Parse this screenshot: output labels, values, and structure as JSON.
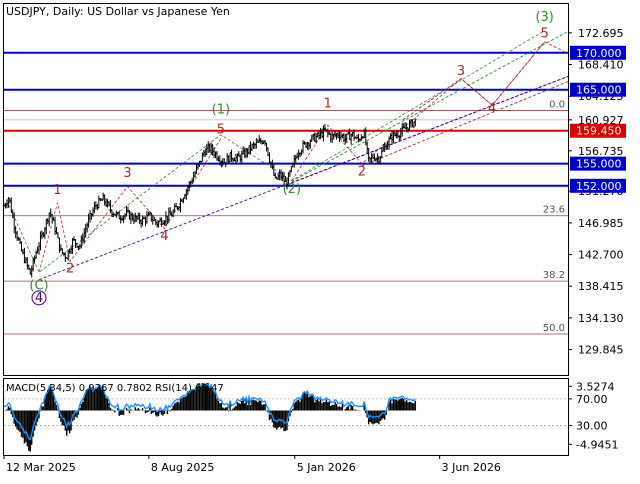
{
  "chart_data": {
    "type": "candlestick",
    "title": "USDJPY, Daily:  US Dollar vs Japanese Yen",
    "indicator_title": "MACD(5,34,5) 0.9267 0.7802 RSI(14) 65.47",
    "x_axis": {
      "tick_labels": [
        "12 Mar 2025",
        "8 Aug 2025",
        "5 Jan 2026",
        "3 Jun 2026"
      ],
      "tick_days": [
        0,
        149,
        299,
        448
      ]
    },
    "y_axis": {
      "ylim": [
        126.4,
        176.6
      ],
      "tick_labels": [
        "172.695",
        "168.410",
        "164.125",
        "160.927",
        "156.735",
        "151.270",
        "146.985",
        "142.700",
        "138.415",
        "134.130",
        "129.845"
      ],
      "tick_values": [
        172.695,
        168.41,
        164.125,
        160.927,
        156.735,
        151.27,
        146.985,
        142.7,
        138.415,
        134.13,
        129.845
      ]
    },
    "indicator_axis": {
      "ylim": [
        -6.5,
        4.6
      ],
      "tick_labels": [
        "3.5274",
        "70.00",
        "30.00",
        "-4.9451"
      ],
      "tick_values": [
        3.5274,
        1.7,
        -2.2,
        -4.9451
      ]
    },
    "levels": [
      {
        "label": "170.000",
        "value": 170.0,
        "color": "#0000cc"
      },
      {
        "label": "165.000",
        "value": 165.0,
        "color": "#0000cc"
      },
      {
        "label": "159.450",
        "value": 159.45,
        "color": "#dd0000"
      },
      {
        "label": "155.000",
        "value": 155.0,
        "color": "#0000cc"
      },
      {
        "label": "152.000",
        "value": 152.0,
        "color": "#0000cc"
      }
    ],
    "fibonacci": [
      {
        "label": "0.0",
        "value": 162.2
      },
      {
        "label": "23.6",
        "value": 147.95
      },
      {
        "label": "38.2",
        "value": 139.1
      },
      {
        "label": "50.0",
        "value": 131.95
      }
    ],
    "current_price": 160.927,
    "price_path": [
      {
        "d": 0,
        "p": 149.3
      },
      {
        "d": 5,
        "p": 150.5
      },
      {
        "d": 10,
        "p": 147.0
      },
      {
        "d": 17,
        "p": 143.5
      },
      {
        "d": 22,
        "p": 141.8
      },
      {
        "d": 27,
        "p": 140.1
      },
      {
        "d": 33,
        "p": 143.0
      },
      {
        "d": 40,
        "p": 145.6
      },
      {
        "d": 47,
        "p": 148.6
      },
      {
        "d": 53,
        "p": 146.0
      },
      {
        "d": 58,
        "p": 143.2
      },
      {
        "d": 64,
        "p": 142.4
      },
      {
        "d": 71,
        "p": 144.6
      },
      {
        "d": 78,
        "p": 143.9
      },
      {
        "d": 86,
        "p": 147.0
      },
      {
        "d": 94,
        "p": 149.3
      },
      {
        "d": 102,
        "p": 150.2
      },
      {
        "d": 110,
        "p": 148.7
      },
      {
        "d": 118,
        "p": 147.8
      },
      {
        "d": 126,
        "p": 148.2
      },
      {
        "d": 134,
        "p": 147.6
      },
      {
        "d": 142,
        "p": 147.3
      },
      {
        "d": 150,
        "p": 147.9
      },
      {
        "d": 157,
        "p": 146.9
      },
      {
        "d": 165,
        "p": 147.6
      },
      {
        "d": 172,
        "p": 148.1
      },
      {
        "d": 179,
        "p": 149.3
      },
      {
        "d": 186,
        "p": 151.1
      },
      {
        "d": 193,
        "p": 152.8
      },
      {
        "d": 200,
        "p": 154.7
      },
      {
        "d": 206,
        "p": 156.7
      },
      {
        "d": 212,
        "p": 157.1
      },
      {
        "d": 219,
        "p": 156.1
      },
      {
        "d": 226,
        "p": 155.2
      },
      {
        "d": 233,
        "p": 156.0
      },
      {
        "d": 240,
        "p": 155.7
      },
      {
        "d": 247,
        "p": 156.3
      },
      {
        "d": 254,
        "p": 157.2
      },
      {
        "d": 261,
        "p": 157.7
      },
      {
        "d": 268,
        "p": 158.4
      },
      {
        "d": 274,
        "p": 155.1
      },
      {
        "d": 279,
        "p": 152.7
      },
      {
        "d": 284,
        "p": 153.5
      },
      {
        "d": 290,
        "p": 152.3
      },
      {
        "d": 296,
        "p": 154.3
      },
      {
        "d": 302,
        "p": 156.6
      },
      {
        "d": 308,
        "p": 157.4
      },
      {
        "d": 316,
        "p": 158.3
      },
      {
        "d": 323,
        "p": 158.7
      },
      {
        "d": 330,
        "p": 159.4
      },
      {
        "d": 337,
        "p": 158.6
      },
      {
        "d": 344,
        "p": 159.1
      },
      {
        "d": 351,
        "p": 158.4
      },
      {
        "d": 358,
        "p": 159.0
      },
      {
        "d": 364,
        "p": 158.1
      },
      {
        "d": 370,
        "p": 159.3
      },
      {
        "d": 375,
        "p": 155.3
      },
      {
        "d": 380,
        "p": 156.0
      },
      {
        "d": 385,
        "p": 155.7
      },
      {
        "d": 392,
        "p": 157.3
      },
      {
        "d": 399,
        "p": 158.7
      },
      {
        "d": 407,
        "p": 159.2
      },
      {
        "d": 416,
        "p": 160.1
      },
      {
        "d": 424,
        "p": 160.9
      }
    ],
    "wave_labels": [
      {
        "text": "1",
        "d": 55,
        "p": 150.9,
        "color": "#a52a2a",
        "style": "plain"
      },
      {
        "text": "2",
        "d": 68,
        "p": 140.3,
        "color": "#a52a2a",
        "style": "plain"
      },
      {
        "text": "3",
        "d": 127,
        "p": 153.2,
        "color": "#a52a2a",
        "style": "plain"
      },
      {
        "text": "4",
        "d": 165,
        "p": 144.7,
        "color": "#a52a2a",
        "style": "plain"
      },
      {
        "text": "5",
        "d": 223,
        "p": 159.1,
        "color": "#a52a2a",
        "style": "plain"
      },
      {
        "text": "(1)",
        "d": 223,
        "p": 161.8,
        "color": "#2e8b2e",
        "style": "plain"
      },
      {
        "text": "(2)",
        "d": 296,
        "p": 151.0,
        "color": "#2e8b2e",
        "style": "plain"
      },
      {
        "text": "(C)",
        "d": 36,
        "p": 138.0,
        "color": "#2e8b2e",
        "style": "plain"
      },
      {
        "text": "4",
        "d": 36,
        "p": 136.3,
        "color": "#4b0082",
        "style": "circle"
      },
      {
        "text": "1",
        "d": 333,
        "p": 162.6,
        "color": "#a52a2a",
        "style": "plain"
      },
      {
        "text": "2",
        "d": 368,
        "p": 153.4,
        "color": "#a52a2a",
        "style": "plain"
      },
      {
        "text": "3",
        "d": 470,
        "p": 167.0,
        "color": "#a52a2a",
        "style": "plain"
      },
      {
        "text": "4",
        "d": 502,
        "p": 161.9,
        "color": "#a52a2a",
        "style": "plain"
      },
      {
        "text": "5",
        "d": 556,
        "p": 172.1,
        "color": "#a52a2a",
        "style": "plain"
      },
      {
        "text": "(3)",
        "d": 556,
        "p": 174.3,
        "color": "#2e8b2e",
        "style": "plain"
      }
    ],
    "wave_paths": [
      {
        "color": "#2e8b2e",
        "points": [
          {
            "d": 5,
            "p": 149.4
          },
          {
            "d": 36,
            "p": 140.3
          },
          {
            "d": 223,
            "p": 158.9
          },
          {
            "d": 296,
            "p": 152.7
          },
          {
            "d": 556,
            "p": 173.0
          }
        ]
      },
      {
        "color": "#a52a2a",
        "points": [
          {
            "d": 36,
            "p": 140.3
          },
          {
            "d": 55,
            "p": 149.7
          },
          {
            "d": 68,
            "p": 141.8
          },
          {
            "d": 127,
            "p": 151.9
          },
          {
            "d": 165,
            "p": 146.2
          },
          {
            "d": 223,
            "p": 158.4
          }
        ]
      },
      {
        "color": "#a52a2a",
        "points": [
          {
            "d": 296,
            "p": 152.7
          },
          {
            "d": 333,
            "p": 160.2
          },
          {
            "d": 368,
            "p": 155.0
          },
          {
            "d": 470,
            "p": 166.5
          },
          {
            "d": 502,
            "p": 162.9
          },
          {
            "d": 556,
            "p": 171.5
          }
        ]
      }
    ],
    "forecast_path": {
      "color": "#a52a2a",
      "points": [
        {
          "d": 410,
          "p": 160.9
        },
        {
          "d": 470,
          "p": 166.5
        },
        {
          "d": 502,
          "p": 162.9
        },
        {
          "d": 556,
          "p": 171.5
        },
        {
          "d": 580,
          "p": 169.9
        }
      ]
    },
    "channels": [
      {
        "color": "#4b0082",
        "points": [
          {
            "d": 36,
            "p": 139.3
          },
          {
            "d": 580,
            "p": 166.8
          }
        ]
      },
      {
        "color": "#4b0082",
        "points": [
          {
            "d": 296,
            "p": 152.4
          },
          {
            "d": 580,
            "p": 166.8
          }
        ]
      },
      {
        "color": "#2e8b2e",
        "points": [
          {
            "d": 296,
            "p": 152.6
          },
          {
            "d": 580,
            "p": 172.9
          }
        ]
      },
      {
        "color": "#a52a2a",
        "points": [
          {
            "d": 368,
            "p": 154.7
          },
          {
            "d": 580,
            "p": 166.1
          }
        ]
      }
    ]
  }
}
